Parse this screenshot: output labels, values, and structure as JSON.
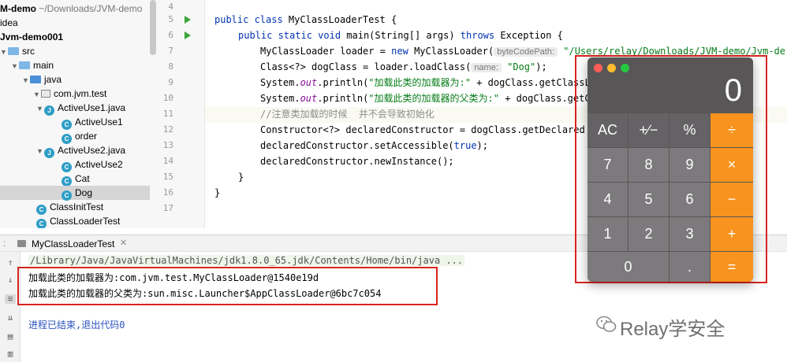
{
  "project": {
    "root_label": "M-demo",
    "root_path": "~/Downloads/JVM-demo",
    "items": [
      {
        "label": "idea"
      },
      {
        "label": "Jvm-demo001"
      },
      {
        "label": "src"
      },
      {
        "label": "main"
      },
      {
        "label": "java"
      },
      {
        "label": "com.jvm.test"
      },
      {
        "label": "ActiveUse1.java"
      },
      {
        "label": "ActiveUse1"
      },
      {
        "label": "order"
      },
      {
        "label": "ActiveUse2.java"
      },
      {
        "label": "ActiveUse2"
      },
      {
        "label": "Cat"
      },
      {
        "label": "Dog"
      },
      {
        "label": "ClassInitTest"
      },
      {
        "label": "ClassLoaderTest"
      }
    ]
  },
  "editor": {
    "line_numbers": [
      "4",
      "5",
      "6",
      "7",
      "8",
      "9",
      "10",
      "11",
      "12",
      "13",
      "14",
      "15",
      "16",
      "17"
    ],
    "code": {
      "l5_a": "public class ",
      "l5_b": "MyClassLoaderTest {",
      "l6_a": "public static void ",
      "l6_b": "main(String[] args) ",
      "l6_c": "throws ",
      "l6_d": "Exception {",
      "l7_a": "MyClassLoader loader = ",
      "l7_b": "new ",
      "l7_c": "MyClassLoader(",
      "l7_hint": "byteCodePath:",
      "l7_d": "\"/Users/relay/Downloads/JVM-demo/Jvm-de",
      "l8_a": "Class<?> dogClass = loader.loadClass(",
      "l8_hint": "name:",
      "l8_b": "\"Dog\"",
      "l8_c": ");",
      "l9_a": "System.",
      "l9_out": "out",
      "l9_b": ".println(",
      "l9_str": "\"加载此类的加载器为:\"",
      "l9_c": " + dogClass.getClassL",
      "l10_a": "System.",
      "l10_out": "out",
      "l10_b": ".println(",
      "l10_str": "\"加载此类的加载器的父类为:\"",
      "l10_c": " + dogClass.getCl",
      "l11": "//注意类加载的时候  并不会导致初始化",
      "l12_a": "Constructor<?> declaredConstructor = dogClass.getDeclared",
      "l13_a": "declaredConstructor.setAccessible(",
      "l13_b": "true",
      "l13_c": ");",
      "l14": "declaredConstructor.newInstance();",
      "l15": "}",
      "l16": "}"
    }
  },
  "run": {
    "tab_label": "MyClassLoaderTest",
    "command": "/Library/Java/JavaVirtualMachines/jdk1.8.0_65.jdk/Contents/Home/bin/java ...",
    "output": [
      "加载此类的加载器为:com.jvm.test.MyClassLoader@1540e19d",
      "加载此类的加载器的父类为:sun.misc.Launcher$AppClassLoader@6bc7c054"
    ],
    "exit_message": "进程已结束,退出代码0"
  },
  "calculator": {
    "display": "0",
    "keys": [
      "AC",
      "+∕−",
      "%",
      "÷",
      "7",
      "8",
      "9",
      "×",
      "4",
      "5",
      "6",
      "−",
      "1",
      "2",
      "3",
      "+",
      "0",
      ".",
      "="
    ]
  },
  "watermark": "Relay学安全",
  "colors": {
    "highlight_box": "#d9241e",
    "operator_key": "#f7931e"
  }
}
